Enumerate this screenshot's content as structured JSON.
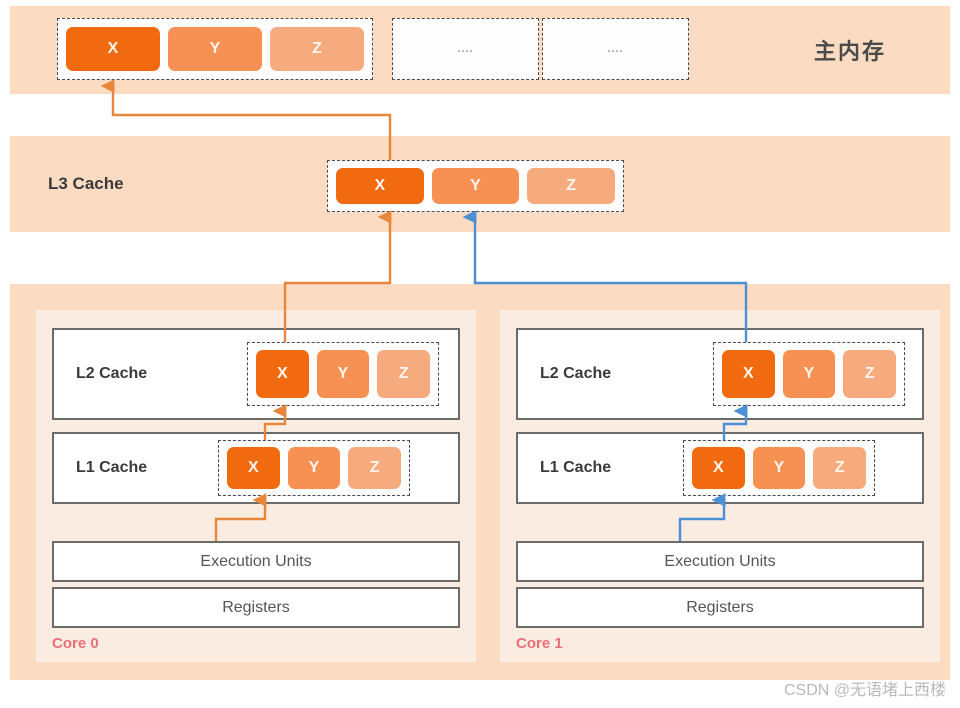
{
  "main_memory": {
    "title": "主内存",
    "cacheline": {
      "cells": [
        "X",
        "Y",
        "Z"
      ]
    },
    "empty_blocks": [
      "....",
      "...."
    ]
  },
  "l3": {
    "title": "L3 Cache",
    "cacheline": {
      "cells": [
        "X",
        "Y",
        "Z"
      ]
    }
  },
  "cores": [
    {
      "label": "Core 0",
      "l2": {
        "title": "L2 Cache",
        "cells": [
          "X",
          "Y",
          "Z"
        ]
      },
      "l1": {
        "title": "L1 Cache",
        "cells": [
          "X",
          "Y",
          "Z"
        ]
      },
      "execution_units": "Execution Units",
      "registers": "Registers"
    },
    {
      "label": "Core 1",
      "l2": {
        "title": "L2 Cache",
        "cells": [
          "X",
          "Y",
          "Z"
        ]
      },
      "l1": {
        "title": "L1 Cache",
        "cells": [
          "X",
          "Y",
          "Z"
        ]
      },
      "execution_units": "Execution Units",
      "registers": "Registers"
    }
  ],
  "colors": {
    "band": "#fbdcc3",
    "core_panel": "#fbece2",
    "cell_x": "#f26a0f",
    "cell_y": "#f79153",
    "cell_z": "#f6ab7f",
    "arrow_core0": "#e8873c",
    "arrow_core1": "#4b8fd4",
    "core_label": "#e8707a"
  },
  "watermark": "CSDN @无语堵上西楼"
}
